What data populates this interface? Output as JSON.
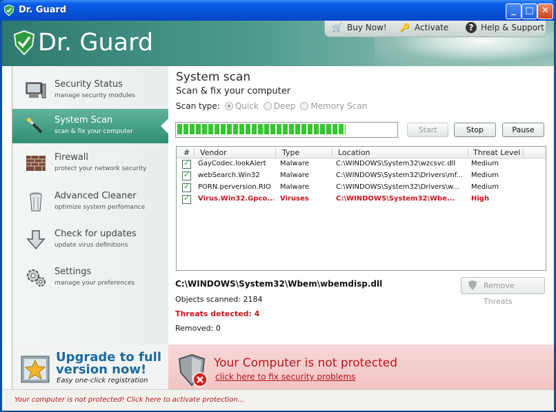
{
  "window": {
    "title": "Dr. Guard",
    "controls": {
      "minimize": "_",
      "maximize": "□",
      "close": "✕"
    }
  },
  "header": {
    "logo_text": "Dr. Guard",
    "links": [
      {
        "label": "Buy Now!",
        "icon": "cart-icon"
      },
      {
        "label": "Activate",
        "icon": "key-icon"
      },
      {
        "label": "Help & Support",
        "icon": "help-icon"
      }
    ]
  },
  "sidebar": {
    "items": [
      {
        "title": "Security Status",
        "subtitle": "manage security modules",
        "icon": "computer-icon",
        "active": false
      },
      {
        "title": "System Scan",
        "subtitle": "scan & fix your computer",
        "icon": "scan-wand-icon",
        "active": true
      },
      {
        "title": "Firewall",
        "subtitle": "protect your network security",
        "icon": "firewall-icon",
        "active": false
      },
      {
        "title": "Advanced Cleaner",
        "subtitle": "optimize system perfomance",
        "icon": "trash-icon",
        "active": false
      },
      {
        "title": "Check for updates",
        "subtitle": "update virus definitions",
        "icon": "download-arrow-icon",
        "active": false
      },
      {
        "title": "Settings",
        "subtitle": "manage your preferences",
        "icon": "gear-icon",
        "active": false
      }
    ],
    "upgrade": {
      "title": "Upgrade to full version now!",
      "subtitle": "Easy one-click registration"
    }
  },
  "main": {
    "title": "System scan",
    "subtitle": "Scan & fix your computer",
    "scan_type": {
      "label": "Scan type:",
      "options": [
        "Quick",
        "Deep",
        "Memory Scan"
      ],
      "selected": "Quick"
    },
    "progress_fraction": 0.77,
    "buttons": {
      "start": "Start",
      "stop": "Stop",
      "pause": "Pause"
    },
    "table": {
      "columns": [
        "#",
        "Vendor",
        "Type",
        "Location",
        "Threat Level"
      ],
      "rows": [
        {
          "vendor": "GayCodec.lookAlert",
          "type": "Malware",
          "location": "C:\\WINDOWS\\System32\\wzcsvc.dll",
          "level": "Medium",
          "highlight": false
        },
        {
          "vendor": "webSearch.Win32",
          "type": "Malware",
          "location": "C:\\WINDOWS\\System32\\Drivers\\mf...",
          "level": "Medium",
          "highlight": false
        },
        {
          "vendor": "PORN.perversion.RIO",
          "type": "Malware",
          "location": "C:\\WINDOWS\\System32\\Drivers\\w...",
          "level": "Medium",
          "highlight": false
        },
        {
          "vendor": "Virus.Win32.Gpco...",
          "type": "Viruses",
          "location": "C:\\WINDOWS\\System32\\Wbe...",
          "level": "High",
          "highlight": true
        }
      ]
    },
    "current_file": "C:\\WINDOWS\\System32\\Wbem\\wbemdisp.dll",
    "objects_scanned": "Objects scanned: 2184",
    "threats_detected": "Threats detected: 4",
    "removed": "Removed: 0",
    "remove_button": "Remove Threats"
  },
  "warning": {
    "title": "Your Computer is not protected",
    "link": "click here to fix security problems"
  },
  "statusbar": {
    "text": "Your computer is not protected! Click here to activate protection..."
  },
  "colors": {
    "accent_green": "#2f8f74",
    "warning_red": "#b81418",
    "upgrade_blue": "#1a6a9e"
  }
}
